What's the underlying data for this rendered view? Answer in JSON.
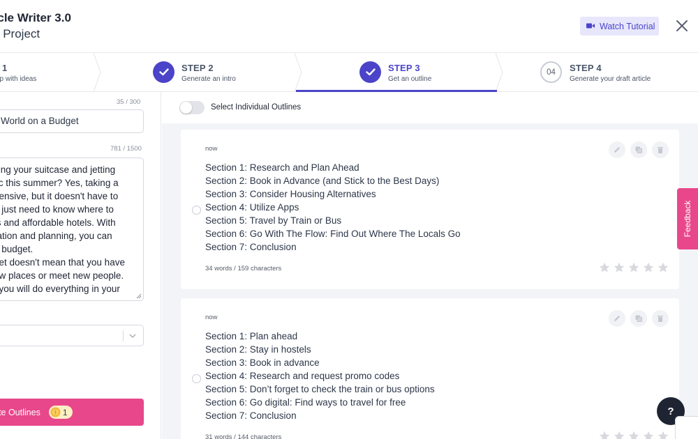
{
  "header": {
    "app_title": "ticle Writer 3.0",
    "project_name": "y Project",
    "watch_tutorial": "Watch Tutorial",
    "accent": "#4b44c9"
  },
  "steps": [
    {
      "title": "1",
      "subtitle": "up with ideas",
      "state": "done"
    },
    {
      "title": "STEP 2",
      "subtitle": "Generate an intro",
      "state": "done"
    },
    {
      "title": "STEP 3",
      "subtitle": "Get an outline",
      "state": "active"
    },
    {
      "title": "STEP 4",
      "subtitle": "Generate your draft article",
      "state": "todo",
      "number": "04"
    }
  ],
  "left": {
    "title_count": "35 / 300",
    "title_value": "World on a Budget",
    "intro_count": "781 / 1500",
    "intro_lines": [
      "king your suitcase and jetting",
      "tic this summer? Yes, taking a",
      "pensive, but it doesn't have to",
      "u just need to know where to",
      "ts and affordable hotels. With",
      "ration and planning, you can",
      "a budget.",
      "get doesn't mean that you have",
      "ew places or meet new people.",
      "t you will do everything in your"
    ],
    "generate_label": "erate Outlines",
    "credit_count": "1",
    "brand_pink": "#e8478b"
  },
  "toggle_label": "Select Individual Outlines",
  "outlines": [
    {
      "time": "now",
      "sections": [
        "Section 1:  Research and Plan Ahead",
        "Section 2:  Book in Advance (and Stick to the Best Days)",
        "Section 3:  Consider Housing Alternatives",
        "Section 4:  Utilize Apps",
        "Section 5:  Travel by Train or Bus",
        "Section 6:  Go With The Flow: Find Out Where The Locals Go",
        "Section 7:  Conclusion"
      ],
      "stats": "34 words / 159 characters",
      "rating": 0
    },
    {
      "time": "now",
      "sections": [
        "Section 1:  Plan ahead",
        "Section 2:  Stay in hostels",
        "Section 3:  Book in advance",
        "Section 4:  Research and request promo codes",
        "Section 5:  Don’t forget to check the train or bus options",
        "Section 6:  Go digital: Find ways to travel for free",
        "Section 7:  Conclusion"
      ],
      "stats": "31 words / 144 characters",
      "rating": 0
    }
  ],
  "feedback_label": "Feedback",
  "help_label": "?",
  "icons": [
    "video-icon",
    "close-icon",
    "check-icon",
    "chevron-down-icon",
    "coin-icon",
    "pencil-icon",
    "copy-icon",
    "trash-icon",
    "star-icon"
  ]
}
